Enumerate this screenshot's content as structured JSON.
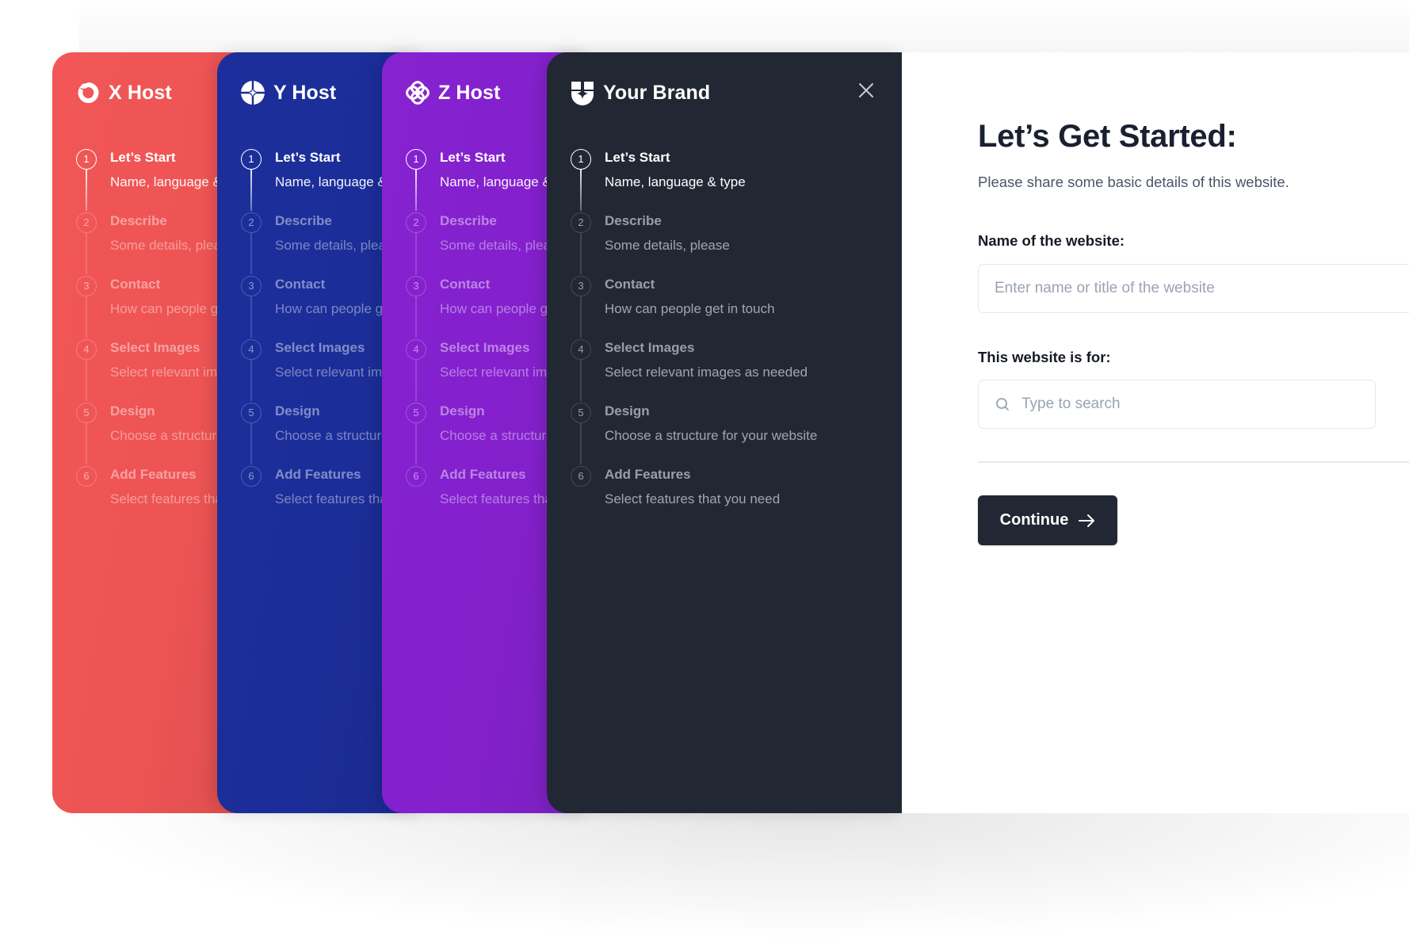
{
  "steps": [
    {
      "number": "1",
      "title": "Let’s Start",
      "subtitle": "Name, language & type",
      "active": true
    },
    {
      "number": "2",
      "title": "Describe",
      "subtitle": "Some details, please",
      "active": false
    },
    {
      "number": "3",
      "title": "Contact",
      "subtitle": "How can people get in touch",
      "active": false
    },
    {
      "number": "4",
      "title": "Select Images",
      "subtitle": "Select relevant images as needed",
      "active": false
    },
    {
      "number": "5",
      "title": "Design",
      "subtitle": "Choose a structure for your website",
      "active": false
    },
    {
      "number": "6",
      "title": "Add Features",
      "subtitle": "Select features that you need",
      "active": false
    }
  ],
  "panels": [
    {
      "id": "x-host",
      "brand": "X Host",
      "logo_icon": "x-host-logo-icon",
      "color": "#EF5353"
    },
    {
      "id": "y-host",
      "brand": "Y Host",
      "logo_icon": "y-host-logo-icon",
      "color": "#1B2E9A"
    },
    {
      "id": "z-host",
      "brand": "Z Host",
      "logo_icon": "z-host-logo-icon",
      "color": "#8421CF"
    },
    {
      "id": "your-brand",
      "brand": "Your Brand",
      "logo_icon": "your-brand-shield-icon",
      "color": "#212733"
    }
  ],
  "close_icon": "close-icon",
  "form": {
    "heading": "Let’s Get Started:",
    "subheading": "Please share some basic details of this website.",
    "name_label": "Name of the website:",
    "name_placeholder": "Enter name or title of the website",
    "name_value": "",
    "purpose_label": "This website is for:",
    "purpose_placeholder": "Type to search",
    "purpose_value": "",
    "continue_label": "Continue",
    "continue_icon": "arrow-right-icon"
  }
}
